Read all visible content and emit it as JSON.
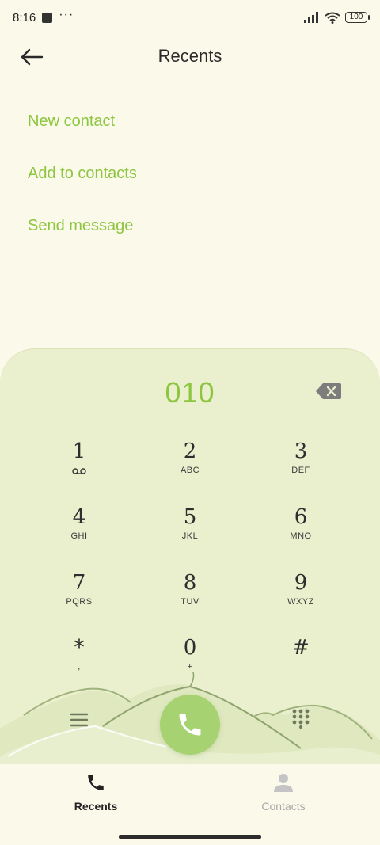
{
  "status_bar": {
    "time": "8:16",
    "overflow": "···",
    "battery": "100",
    "icons": [
      "notification-square-icon",
      "signal-icon",
      "wifi-icon",
      "battery-icon"
    ]
  },
  "header": {
    "title": "Recents",
    "back_icon": "arrow-left-icon"
  },
  "actions": [
    {
      "label": "New contact"
    },
    {
      "label": "Add to contacts"
    },
    {
      "label": "Send message"
    }
  ],
  "dialpad": {
    "number": "010",
    "backspace_icon": "backspace-icon",
    "keys": [
      {
        "digit": "1",
        "letters": "",
        "sub_icon": "voicemail-icon"
      },
      {
        "digit": "2",
        "letters": "ABC"
      },
      {
        "digit": "3",
        "letters": "DEF"
      },
      {
        "digit": "4",
        "letters": "GHI"
      },
      {
        "digit": "5",
        "letters": "JKL"
      },
      {
        "digit": "6",
        "letters": "MNO"
      },
      {
        "digit": "7",
        "letters": "PQRS"
      },
      {
        "digit": "8",
        "letters": "TUV"
      },
      {
        "digit": "9",
        "letters": "WXYZ"
      },
      {
        "digit": "*",
        "letters": ","
      },
      {
        "digit": "0",
        "letters": "+"
      },
      {
        "digit": "#",
        "letters": ""
      }
    ],
    "menu_icon": "hamburger-menu-icon",
    "call_icon": "phone-icon",
    "dialpad_toggle_icon": "dialpad-grid-icon"
  },
  "bottom_nav": {
    "tabs": [
      {
        "label": "Recents",
        "icon": "phone-icon",
        "active": true
      },
      {
        "label": "Contacts",
        "icon": "person-icon",
        "active": false
      }
    ]
  },
  "colors": {
    "accent": "#8cc63f",
    "background": "#fbf9ea",
    "dialpad_background": "#eaefcd",
    "call_button": "#a6d271",
    "inactive_tab": "#a8a8a8"
  }
}
